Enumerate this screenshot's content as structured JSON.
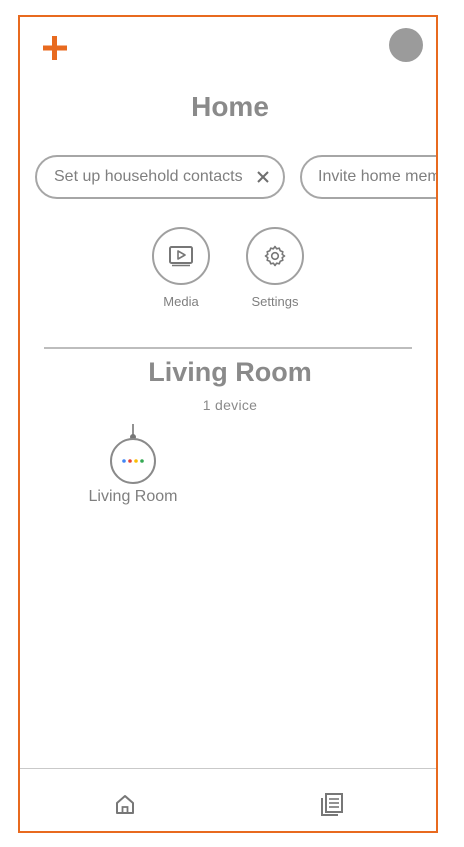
{
  "header": {
    "add_icon": "plus-icon",
    "avatar_icon": "account-avatar",
    "title": "Home"
  },
  "chips": [
    {
      "label": "Set up household contacts",
      "dismissible": true
    },
    {
      "label": "Invite home mem",
      "dismissible": false
    }
  ],
  "quick_actions": [
    {
      "label": "Media",
      "icon": "media-play-icon"
    },
    {
      "label": "Settings",
      "icon": "gear-icon"
    }
  ],
  "room": {
    "title": "Living Room",
    "device_count": "1 device",
    "devices": [
      {
        "label": "Living Room",
        "icon": "smart-speaker-icon",
        "dot_colors": [
          "#4285f4",
          "#ea4335",
          "#fbbc05",
          "#34a853"
        ]
      }
    ]
  },
  "bottom_nav": [
    {
      "icon": "home-icon"
    },
    {
      "icon": "feed-icon"
    }
  ],
  "colors": {
    "accent": "#e86a1f",
    "text": "#8a8a8a",
    "outline": "#a6a6a6",
    "avatar": "#9b9b9b"
  }
}
